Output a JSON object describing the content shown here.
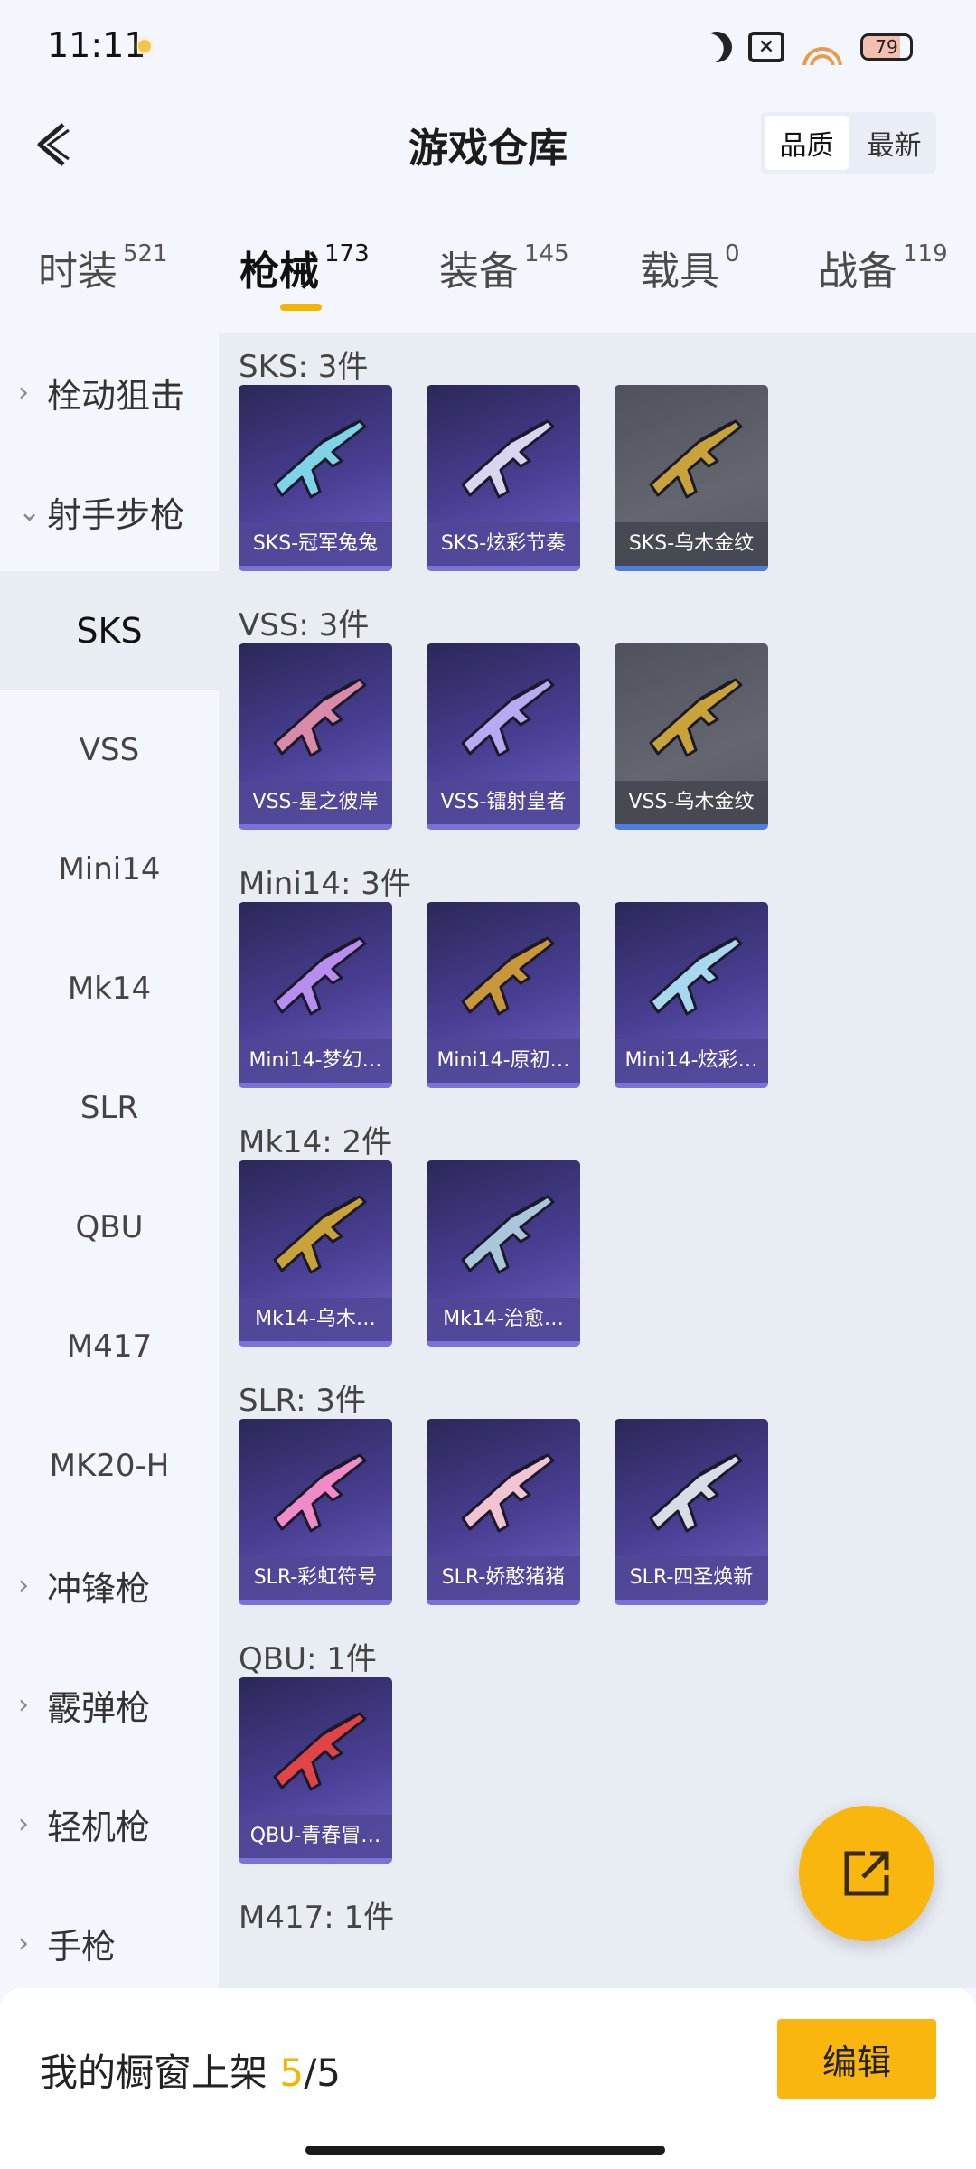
{
  "status": {
    "time": "11:11",
    "battery": "79",
    "battery_level": 0.79
  },
  "header": {
    "title": "游戏仓库",
    "sort_options": [
      "品质",
      "最新"
    ],
    "sort_active": 0
  },
  "tabs": [
    {
      "label": "时装",
      "count": "521"
    },
    {
      "label": "枪械",
      "count": "173"
    },
    {
      "label": "装备",
      "count": "145"
    },
    {
      "label": "载具",
      "count": "0"
    },
    {
      "label": "战备",
      "count": "119"
    }
  ],
  "sidebar": {
    "categories": [
      "栓动狙击",
      "射手步枪",
      "冲锋枪",
      "霰弹枪",
      "轻机枪",
      "手枪"
    ],
    "sub_items": [
      "SKS",
      "VSS",
      "Mini14",
      "Mk14",
      "SLR",
      "QBU",
      "M417",
      "MK20-H"
    ]
  },
  "groups": [
    {
      "title": "SKS: 3件",
      "items": [
        {
          "name": "SKS-冠军兔兔",
          "rarity": "purple",
          "color": "#7ed4e6"
        },
        {
          "name": "SKS-炫彩节奏",
          "rarity": "purple",
          "color": "#d9d4f0"
        },
        {
          "name": "SKS-乌木金纹",
          "rarity": "gray",
          "color": "#c9a23a"
        }
      ]
    },
    {
      "title": "VSS: 3件",
      "items": [
        {
          "name": "VSS-星之彼岸",
          "rarity": "purple",
          "color": "#d98aa8"
        },
        {
          "name": "VSS-镭射皇者",
          "rarity": "purple",
          "color": "#b9a8f2"
        },
        {
          "name": "VSS-乌木金纹",
          "rarity": "gray",
          "color": "#c9a23a"
        }
      ]
    },
    {
      "title": "Mini14: 3件",
      "items": [
        {
          "name": "Mini14-梦幻…",
          "rarity": "purple",
          "color": "#b78ef0"
        },
        {
          "name": "Mini14-原初…",
          "rarity": "purple",
          "color": "#c9973a"
        },
        {
          "name": "Mini14-炫彩…",
          "rarity": "purple",
          "color": "#a8d8ee"
        }
      ]
    },
    {
      "title": "Mk14: 2件",
      "items": [
        {
          "name": "Mk14-乌木…",
          "rarity": "purple",
          "color": "#c9a23a"
        },
        {
          "name": "Mk14-治愈…",
          "rarity": "purple",
          "color": "#a9c6da"
        }
      ]
    },
    {
      "title": "SLR: 3件",
      "items": [
        {
          "name": "SLR-彩虹符号",
          "rarity": "purple",
          "color": "#f08ac8"
        },
        {
          "name": "SLR-娇憨猪猪",
          "rarity": "purple",
          "color": "#f2c4d2"
        },
        {
          "name": "SLR-四圣焕新",
          "rarity": "purple",
          "color": "#d8dce6"
        }
      ]
    },
    {
      "title": "QBU: 1件",
      "items": [
        {
          "name": "QBU-青春冒…",
          "rarity": "purple",
          "color": "#e04444"
        }
      ]
    },
    {
      "title": "M417: 1件",
      "items": []
    }
  ],
  "footer": {
    "label": "我的橱窗上架",
    "current": "5",
    "total": "/5",
    "edit_label": "编辑"
  },
  "colors": {
    "accent": "#f8b60e",
    "card_purple": "#4a3f94",
    "card_gray": "#5b5e68"
  }
}
